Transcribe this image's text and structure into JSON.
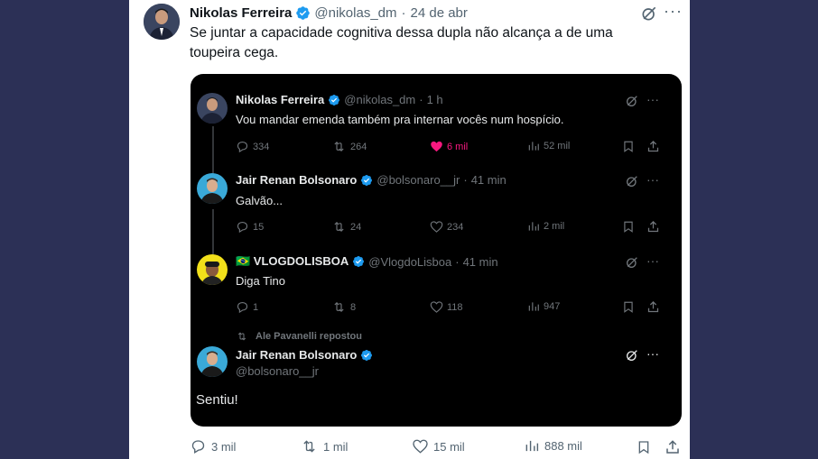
{
  "tweet": {
    "author_name": "Nikolas Ferreira",
    "handle": "@nikolas_dm",
    "separator": "·",
    "date": "24 de abr",
    "text": "Se juntar a capacidade cognitiva dessa dupla não alcança a de uma toupeira cega.",
    "more_label": "···",
    "actions": {
      "replies": "3 mil",
      "retweets": "1 mil",
      "likes": "15 mil",
      "views": "888 mil"
    }
  },
  "embed": {
    "posts": [
      {
        "name": "Nikolas Ferreira",
        "handle": "@nikolas_dm",
        "time": "1 h",
        "text": "Vou mandar emenda também pra internar vocês num hospício.",
        "replies": "334",
        "retweets": "264",
        "likes": "6 mil",
        "views": "52 mil"
      },
      {
        "name": "Jair Renan Bolsonaro",
        "handle": "@bolsonaro__jr",
        "time": "41 min",
        "text": "Galvão...",
        "replies": "15",
        "retweets": "24",
        "likes": "234",
        "views": "2 mil"
      },
      {
        "name": "🇧🇷 VLOGDOLISBOA",
        "handle": "@VlogdoLisboa",
        "time": "41 min",
        "text": "Diga Tino",
        "replies": "1",
        "retweets": "8",
        "likes": "118",
        "views": "947"
      }
    ],
    "repost_label": "Ale Pavanelli repostou",
    "final_post": {
      "name": "Jair Renan Bolsonaro",
      "handle": "@bolsonaro__jr",
      "text": "Sentiu!"
    },
    "separator": "·",
    "more_label": "···"
  },
  "colors": {
    "background": "#2c3056",
    "verified": "#1d9bf0",
    "like_active": "#f91880"
  }
}
